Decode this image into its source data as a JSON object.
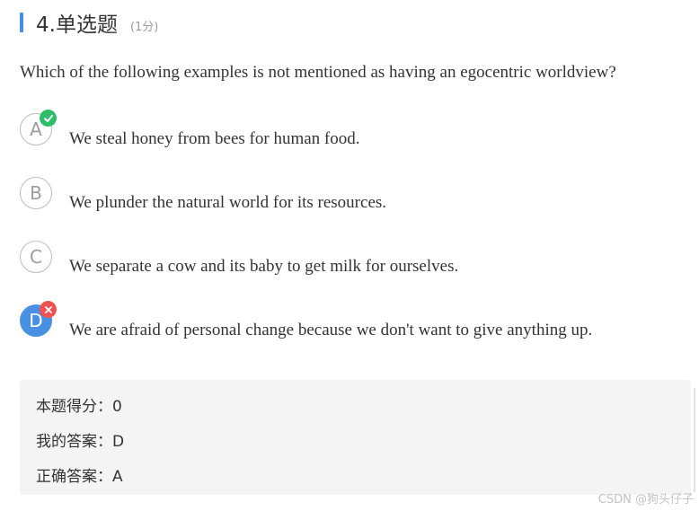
{
  "header": {
    "title": "4.单选题",
    "score": "(1分)"
  },
  "question": {
    "text": "Which of the following examples is not mentioned as having an egocentric worldview?"
  },
  "options": [
    {
      "letter": "A",
      "text": "We steal honey from bees for human food.",
      "mark": "correct-check-icon"
    },
    {
      "letter": "B",
      "text": "We plunder the natural world for its resources."
    },
    {
      "letter": "C",
      "text": "We separate a cow and its baby to get milk for ourselves."
    },
    {
      "letter": "D",
      "text": "We are afraid of personal change because we don't want to give anything up.",
      "selected": true,
      "mark": "wrong-cross-icon"
    }
  ],
  "result": {
    "score_line": "本题得分：0",
    "my_answer": "我的答案：D",
    "correct_answer": "正确答案：A"
  },
  "watermark": "CSDN @狗头仔子",
  "colors": {
    "accent": "#4a90e2",
    "correct": "#2ebd6b",
    "wrong": "#ef5350",
    "panel_bg": "#f4f4f4"
  }
}
